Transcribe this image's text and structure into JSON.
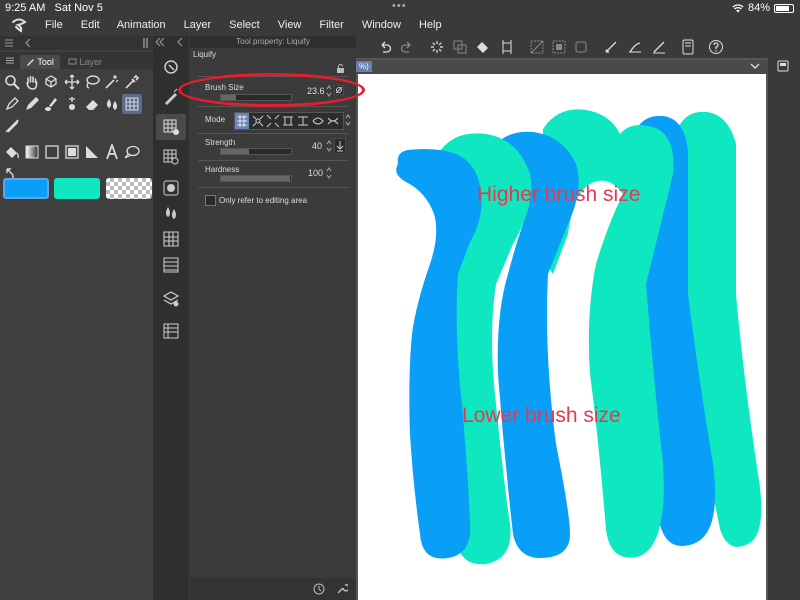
{
  "statusbar": {
    "time": "9:25 AM",
    "date": "Sat Nov 5",
    "battery": "84%",
    "battery_fraction": 0.84,
    "dots": "•••"
  },
  "menubar": {
    "items": [
      "File",
      "Edit",
      "Animation",
      "Layer",
      "Select",
      "View",
      "Filter",
      "Window",
      "Help"
    ]
  },
  "left_panel": {
    "tabs": [
      "Tool",
      "Layer"
    ],
    "colors": {
      "main": "#0a9ff6",
      "sub": "#0fe7c1"
    }
  },
  "tool_property": {
    "header": "Tool property: Liquify",
    "tool_name": "Liquify",
    "brush_size": {
      "label": "Brush Size",
      "value": "23.6",
      "fraction": 0.22
    },
    "mode": {
      "label": "Mode"
    },
    "strength": {
      "label": "Strength",
      "value": "40",
      "fraction": 0.4
    },
    "hardness": {
      "label": "Hardness",
      "value": "100",
      "fraction": 0.99
    },
    "only_refer": {
      "label": "Only refer to editing area",
      "checked": false
    }
  },
  "canvas": {
    "zoom_fragment": "%)",
    "annotation_high": "Higher brush size",
    "annotation_low": "Lower brush size"
  },
  "colors": {
    "accent_red": "#e31e2d",
    "stroke_blue": "#0a9ff6",
    "stroke_teal": "#0fe7c1"
  }
}
